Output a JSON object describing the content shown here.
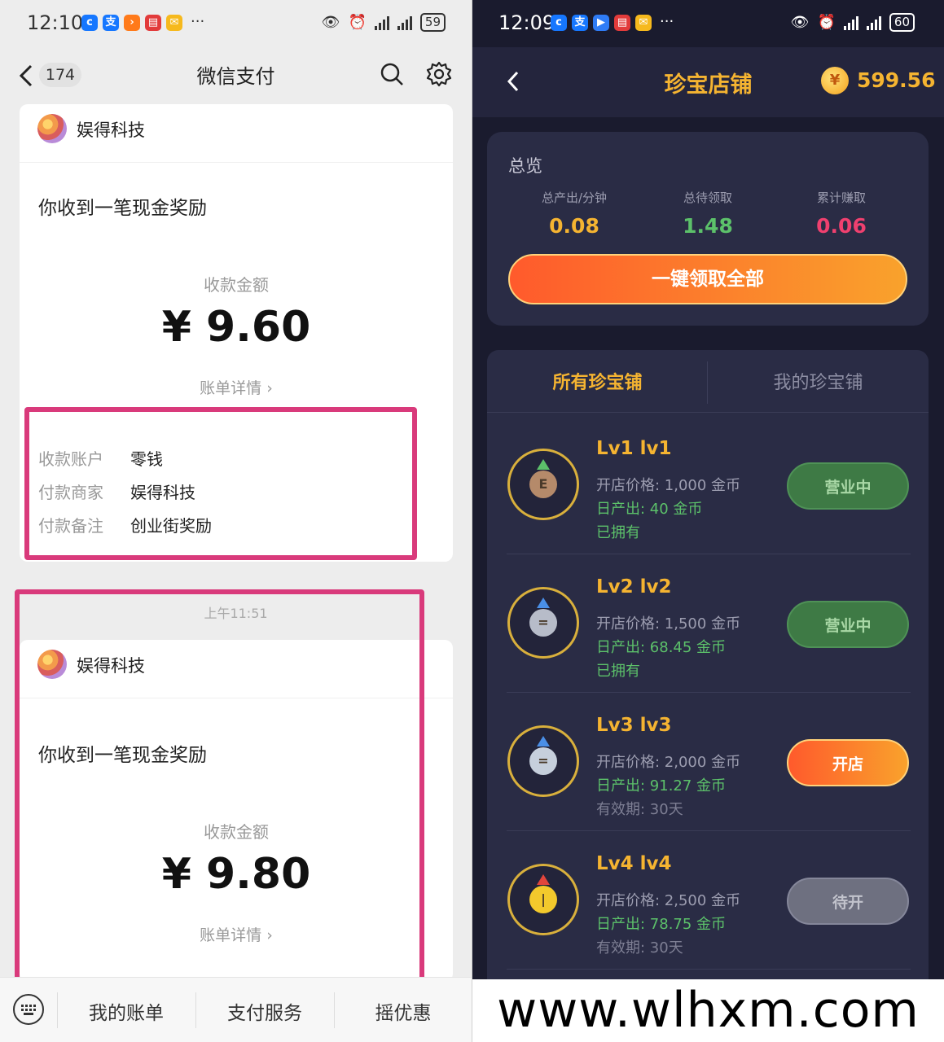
{
  "left": {
    "status_bar": {
      "time": "12:10",
      "battery": "59",
      "more": "···"
    },
    "nav": {
      "back_count": "174",
      "title": "微信支付"
    },
    "card1": {
      "merchant": "娱得科技",
      "message": "你收到一笔现金奖励",
      "amount_label": "收款金额",
      "amount": "¥ 9.60",
      "detail_link": "账单详情 ›",
      "rows": [
        {
          "key": "收款账户",
          "value": "零钱"
        },
        {
          "key": "付款商家",
          "value": "娱得科技"
        },
        {
          "key": "付款备注",
          "value": "创业街奖励"
        }
      ]
    },
    "time_separator": "上午11:51",
    "card2": {
      "merchant": "娱得科技",
      "message": "你收到一笔现金奖励",
      "amount_label": "收款金额",
      "amount": "¥ 9.80",
      "detail_link": "账单详情 ›"
    },
    "bottom_bar": {
      "items": [
        "我的账单",
        "支付服务",
        "摇优惠"
      ]
    },
    "colors": {
      "highlight": "#d93a7b"
    }
  },
  "right": {
    "status_bar": {
      "time": "12:09",
      "battery": "60",
      "more": "···"
    },
    "nav": {
      "title": "珍宝店铺",
      "coin_symbol": "¥",
      "coin_balance": "599.56"
    },
    "overview": {
      "title": "总览",
      "stats": [
        {
          "label": "总产出/分钟",
          "value": "0.08",
          "color": "#f5b431"
        },
        {
          "label": "总待领取",
          "value": "1.48",
          "color": "#5cc16a"
        },
        {
          "label": "累计赚取",
          "value": "0.06",
          "color": "#f0406f"
        }
      ],
      "claim_button": "一键领取全部"
    },
    "tabs": [
      {
        "label": "所有珍宝铺",
        "active": true
      },
      {
        "label": "我的珍宝铺",
        "active": false
      }
    ],
    "shops": [
      {
        "name": "Lv1 lv1",
        "price": "开店价格: 1,000 金币",
        "output": "日产出: 40 金币",
        "extra": "已拥有",
        "button": "营业中",
        "button_style": "open",
        "gem_color": "#b58a6a",
        "gem_glyph": "E"
      },
      {
        "name": "Lv2 lv2",
        "price": "开店价格: 1,500 金币",
        "output": "日产出: 68.45 金币",
        "extra": "已拥有",
        "button": "营业中",
        "button_style": "open",
        "gem_color": "#b7bcc9",
        "gem_glyph": "="
      },
      {
        "name": "Lv3 lv3",
        "price": "开店价格: 2,000 金币",
        "output": "日产出: 91.27 金币",
        "extra": "有效期: 30天",
        "button": "开店",
        "button_style": "buy",
        "gem_color": "#c6cfdc",
        "gem_glyph": "="
      },
      {
        "name": "Lv4 lv4",
        "price": "开店价格: 2,500 金币",
        "output": "日产出: 78.75 金币",
        "extra": "有效期: 30天",
        "button": "待开",
        "button_style": "pending",
        "gem_color": "#f3c92c",
        "gem_glyph": "|"
      }
    ]
  },
  "watermark": "www.wlhxm.com"
}
